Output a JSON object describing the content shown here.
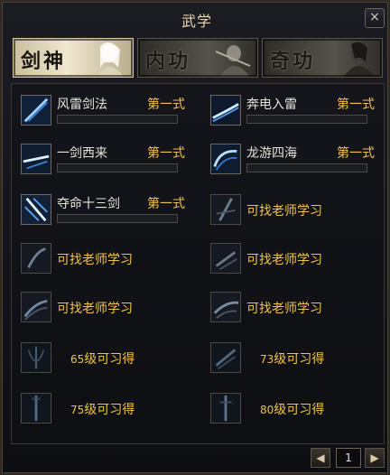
{
  "window": {
    "title": "武学",
    "close_label": "×"
  },
  "tabs": [
    {
      "label": "剑神",
      "active": true
    },
    {
      "label": "内功",
      "active": false
    },
    {
      "label": "奇功",
      "active": false
    }
  ],
  "skills": [
    {
      "name": "风雷剑法",
      "level": "第一式",
      "icon": "wind-thunder-sword-icon",
      "progress": 0
    },
    {
      "name": "奔电入雷",
      "level": "第一式",
      "icon": "lightning-strike-icon",
      "progress": 0
    },
    {
      "name": "一剑西来",
      "level": "第一式",
      "icon": "sword-from-west-icon",
      "progress": 0
    },
    {
      "name": "龙游四海",
      "level": "第一式",
      "icon": "dragon-roam-icon",
      "progress": 0
    },
    {
      "name": "夺命十三剑",
      "level": "第一式",
      "icon": "thirteen-swords-icon",
      "progress": 0
    },
    {
      "learn": "可找老师学习",
      "icon": "locked-skill-icon"
    },
    {
      "learn": "可找老师学习",
      "icon": "locked-skill-icon"
    },
    {
      "learn": "可找老师学习",
      "icon": "locked-skill-icon"
    },
    {
      "learn": "可找老师学习",
      "icon": "locked-skill-icon"
    },
    {
      "learn": "可找老师学习",
      "icon": "locked-skill-icon"
    },
    {
      "req_level": "65",
      "req_text": "级可习得",
      "icon": "level-locked-icon"
    },
    {
      "req_level": "73",
      "req_text": "级可习得",
      "icon": "level-locked-icon"
    },
    {
      "req_level": "75",
      "req_text": "级可习得",
      "icon": "level-locked-icon"
    },
    {
      "req_level": "80",
      "req_text": "级可习得",
      "icon": "level-locked-icon"
    }
  ],
  "pager": {
    "prev_label": "◀",
    "page": "1",
    "next_label": "▶"
  },
  "colors": {
    "accent_gold": "#f0c34a",
    "text_light": "#e6e2d8",
    "progress_blue": "#3b6cc1"
  }
}
